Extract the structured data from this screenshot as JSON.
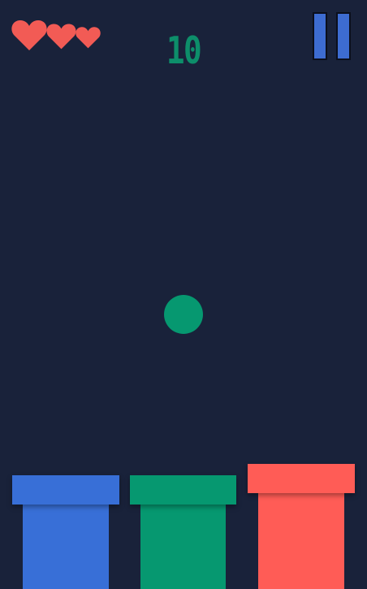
{
  "hud": {
    "score": "10",
    "lives": 3,
    "hearts": [
      "heart-icon",
      "heart-icon",
      "heart-icon"
    ],
    "pause_icon": "pause-icon"
  },
  "ball": {
    "color": "#069870"
  },
  "pipes": [
    {
      "color": "#386fd7",
      "name": "blue"
    },
    {
      "color": "#069870",
      "name": "green"
    },
    {
      "color": "#ff5c56",
      "name": "red"
    }
  ],
  "colors": {
    "background": "#19223a",
    "heart": "#f25b55",
    "score": "#0d8e6a",
    "pause": "#3d6cd1"
  }
}
